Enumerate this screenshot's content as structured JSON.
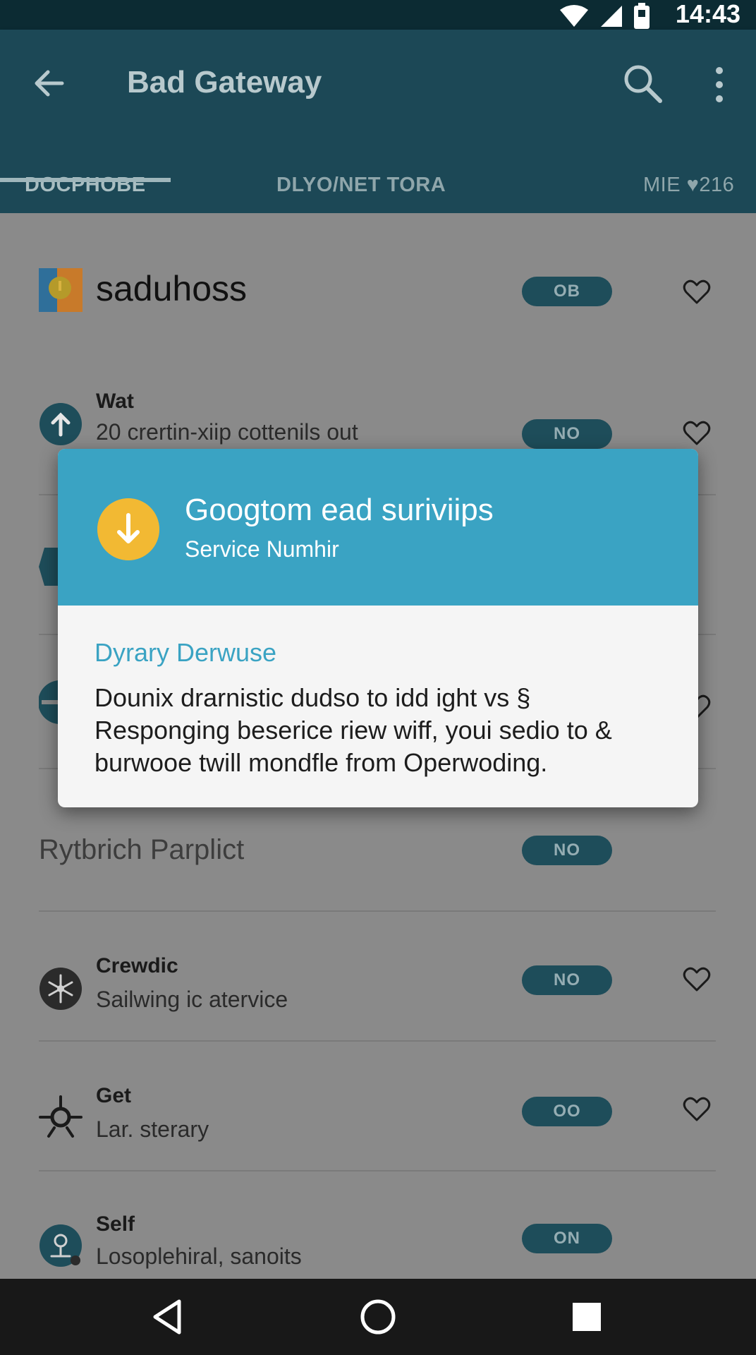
{
  "status_bar": {
    "time": "14:43",
    "icons": [
      "wifi-icon",
      "signal-icon",
      "battery-icon"
    ]
  },
  "app_bar": {
    "title": "Bad Gateway",
    "tabs": [
      {
        "label": "DOCPHOBE",
        "active": true
      },
      {
        "label": "DLYO/NET TORA",
        "active": false
      },
      {
        "label": "MIE ♥216",
        "active": false
      }
    ]
  },
  "list": {
    "rows": [
      {
        "title": "saduhoss",
        "subtitle": "",
        "toggle": "OB",
        "favorite": true
      },
      {
        "title": "Wat",
        "subtitle": "20 crertin-xiip cottenils out",
        "toggle": "NO",
        "favorite": true
      },
      {
        "title": "Rytbrich Parplict",
        "subtitle": "",
        "toggle": "NO",
        "favorite": false
      },
      {
        "title": "Crewdic",
        "subtitle": "Sailwing ic atervice",
        "toggle": "NO",
        "favorite": true
      },
      {
        "title": "Get",
        "subtitle": "Lar. sterary",
        "toggle": "OO",
        "favorite": true
      },
      {
        "title": "Self",
        "subtitle": "Losoplehiral, sanoits",
        "toggle": "ON",
        "favorite": false
      }
    ]
  },
  "dialog": {
    "title": "Googtom ead suriviips",
    "subtitle": "Service Numhir",
    "section_title": "Dyrary Derwuse",
    "body": "Dounix drarnistic dudso to idd ight vs § Responging beserice riew wiff, youi sedio to & burwooe twill mondfle from Operwoding."
  },
  "colors": {
    "app_bar": "#1c4856",
    "dialog_header": "#3aa3c3",
    "dialog_icon": "#f2b933",
    "pill": "#1e4d5a",
    "scrim": "#8a8a8a"
  }
}
